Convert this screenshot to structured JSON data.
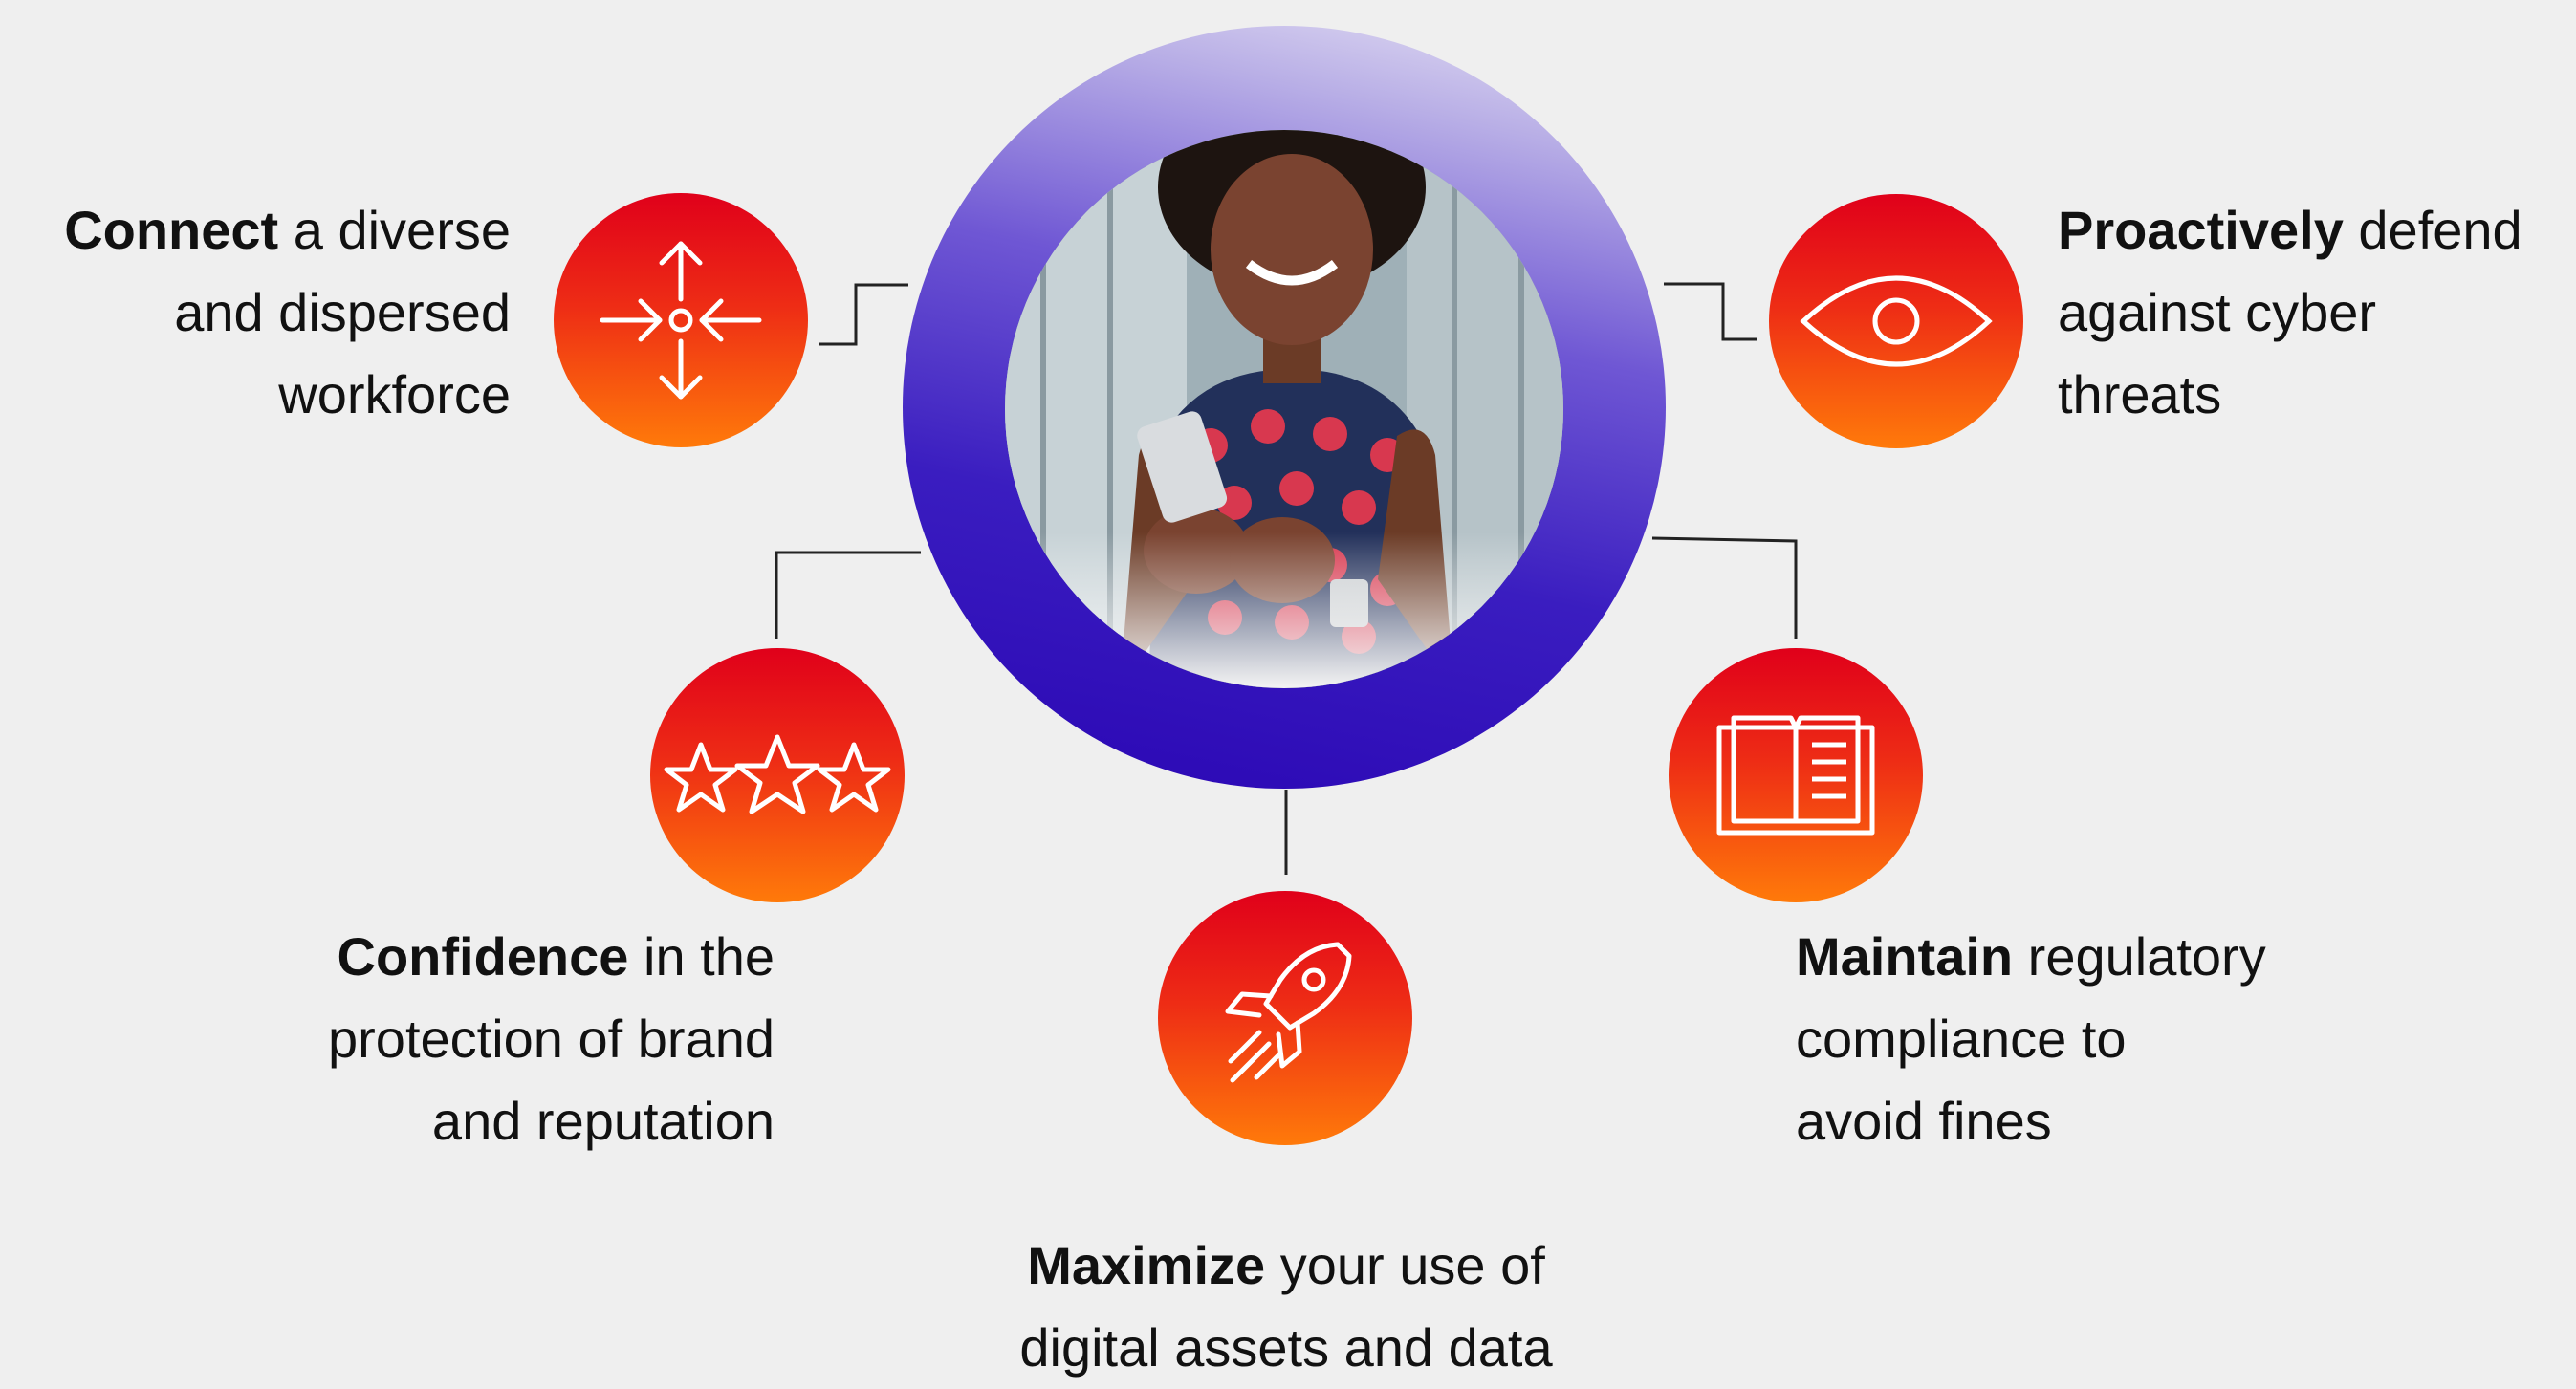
{
  "hub": {
    "photo": "woman-smiling-at-phone"
  },
  "colors": {
    "background": "#efefef",
    "ring_dark": "#2a06b4",
    "ring_light": "#e6e2f4",
    "icon_top": "#e0001a",
    "icon_bottom": "#ff7a0a",
    "connector": "#222222",
    "text": "#111111"
  },
  "items": {
    "connect": {
      "icon": "arrows-converging-icon",
      "bold": "Connect",
      "text": " a diverse",
      "line2": "and dispersed",
      "line3": "workforce"
    },
    "proactively": {
      "icon": "eye-icon",
      "bold": "Proactively",
      "text": " defend",
      "line2": "against cyber",
      "line3": "threats"
    },
    "confidence": {
      "icon": "three-stars-icon",
      "bold": "Confidence",
      "text": " in the",
      "line2": "protection of brand",
      "line3": "and reputation"
    },
    "maintain": {
      "icon": "open-book-icon",
      "bold": "Maintain",
      "text": " regulatory",
      "line2": "compliance to",
      "line3": "avoid fines"
    },
    "maximize": {
      "icon": "rocket-icon",
      "bold": "Maximize",
      "text": " your use of",
      "line2": "digital assets and data"
    }
  }
}
